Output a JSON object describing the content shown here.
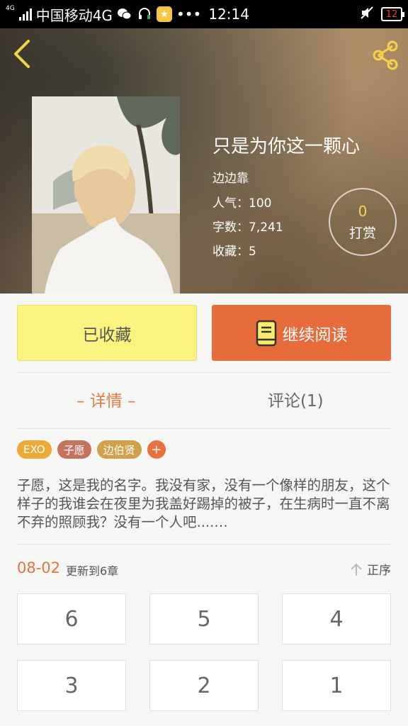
{
  "status_bar": {
    "network_tag": "4G",
    "carrier": "中国移动4G",
    "dots": "•••",
    "time": "12:14",
    "battery": "12"
  },
  "header": {
    "back_icon": "chevron-left-icon",
    "share_icon": "share-icon"
  },
  "book": {
    "title": "只是为你这一颗心",
    "author": "边边靠",
    "popularity_label": "人气：",
    "popularity": "100",
    "words_label": "字数：",
    "words": "7,241",
    "favorites_label": "收藏：",
    "favorites": "5"
  },
  "tip": {
    "count": "0",
    "label": "打赏"
  },
  "actions": {
    "favorited_label": "已收藏",
    "continue_label": "继续阅读"
  },
  "tabs": [
    {
      "label": "– 详情 –",
      "active": true
    },
    {
      "label": "评论(1)",
      "active": false
    }
  ],
  "tags": [
    {
      "label": "EXO",
      "color": "#f0a836"
    },
    {
      "label": "子愿",
      "color": "#c5735d"
    },
    {
      "label": "边伯贤",
      "color": "#d0a04a"
    }
  ],
  "tag_add": "+",
  "summary": "子愿，这是我的名字。我没有家，没有一个像样的朋友，这个样子的我谁会在夜里为我盖好踢掉的被子，在生病时一直不离不弃的照顾我？没有一个人吧....…",
  "chapters": {
    "date": "08-02",
    "update_text": "更新到6章",
    "sort_label": "正序",
    "items": [
      "6",
      "5",
      "4",
      "3",
      "2",
      "1"
    ]
  },
  "colors": {
    "accent": "#e86b3c",
    "favorite_button": "#fbf37f",
    "tip_count": "#f5d44a"
  }
}
